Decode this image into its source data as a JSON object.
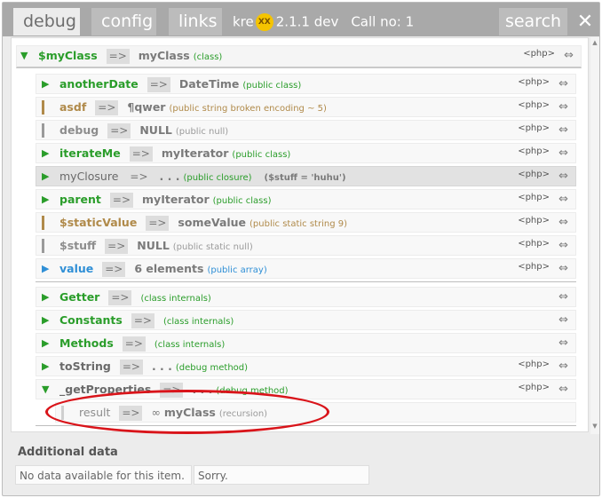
{
  "header": {
    "tabs": [
      {
        "label": "debug",
        "active": true
      },
      {
        "label": "config",
        "active": false
      },
      {
        "label": "links",
        "active": false
      }
    ],
    "version_prefix": "kre",
    "logo_text": "XX",
    "version": "2.1.1 dev",
    "call_no": "Call no: 1",
    "search_label": "search",
    "close_label": "✕"
  },
  "class_row": {
    "toggle": "▼",
    "name": "$myClass",
    "arrow": "=>",
    "value": "myClass",
    "hint": "(class)",
    "php": "<php>",
    "icon": "⇔"
  },
  "properties": [
    {
      "toggle": "▶",
      "name": "anotherDate",
      "arrow": "=>",
      "value": "DateTime",
      "hint": "(public class)",
      "php": "<php>",
      "icon": "⇔"
    },
    {
      "toggle": "",
      "name": "asdf",
      "arrow": "=>",
      "value": "¶qwer",
      "hint": "(public string broken encoding ~ 5)",
      "php": "<php>",
      "icon": "⇔"
    },
    {
      "toggle": "",
      "name": "debug",
      "arrow": "=>",
      "value": "NULL",
      "hint": "(public null)",
      "php": "<php>",
      "icon": "⇔"
    },
    {
      "toggle": "▶",
      "name": "iterateMe",
      "arrow": "=>",
      "value": "myIterator",
      "hint": "(public class)",
      "php": "<php>",
      "icon": "⇔"
    },
    {
      "toggle": "▶",
      "name": "myClosure",
      "arrow": "=>",
      "value": ". . .",
      "hint": "(public closure)",
      "extra": "($stuff = 'huhu')",
      "php": "<php>",
      "icon": "⇔"
    },
    {
      "toggle": "▶",
      "name": "parent",
      "arrow": "=>",
      "value": "myIterator",
      "hint": "(public class)",
      "php": "<php>",
      "icon": "⇔"
    },
    {
      "toggle": "",
      "name": "$staticValue",
      "arrow": "=>",
      "value": "someValue",
      "hint": "(public static string 9)",
      "php": "<php>",
      "icon": "⇔"
    },
    {
      "toggle": "",
      "name": "$stuff",
      "arrow": "=>",
      "value": "NULL",
      "hint": "(public static null)",
      "php": "<php>",
      "icon": "⇔"
    },
    {
      "toggle": "▶",
      "name": "value",
      "arrow": "=>",
      "value": "6 elements",
      "hint": "(public array)",
      "php": "<php>",
      "icon": "⇔"
    }
  ],
  "internals": [
    {
      "toggle": "▶",
      "name": "Getter",
      "arrow": "=>",
      "hint": "(class internals)",
      "icon": "⇔"
    },
    {
      "toggle": "▶",
      "name": "Constants",
      "arrow": "=>",
      "hint": "(class internals)",
      "icon": "⇔"
    },
    {
      "toggle": "▶",
      "name": "Methods",
      "arrow": "=>",
      "hint": "(class internals)",
      "icon": "⇔"
    },
    {
      "toggle": "▶",
      "name": "toString",
      "arrow": "=>",
      "value": ". . .",
      "hint": "(debug method)",
      "php": "<php>",
      "icon": "⇔"
    },
    {
      "toggle": "▼",
      "name": "_getProperties",
      "arrow": "=>",
      "value": ". . .",
      "hint": "(debug method)",
      "php": "<php>",
      "icon": "⇔"
    }
  ],
  "recursion_row": {
    "name": "result",
    "arrow": "=>",
    "symbol": "∞",
    "value": "myClass",
    "hint": "(recursion)"
  },
  "scrollbar": {
    "up": "▲",
    "down": "▼"
  },
  "footer": {
    "title": "Additional data",
    "message": "No data available for this item.",
    "apology": "Sorry."
  },
  "colors": {
    "accent_green": "#2a9d2a",
    "header_grey": "#a9a9a9",
    "annotation_red": "#d9141a"
  }
}
